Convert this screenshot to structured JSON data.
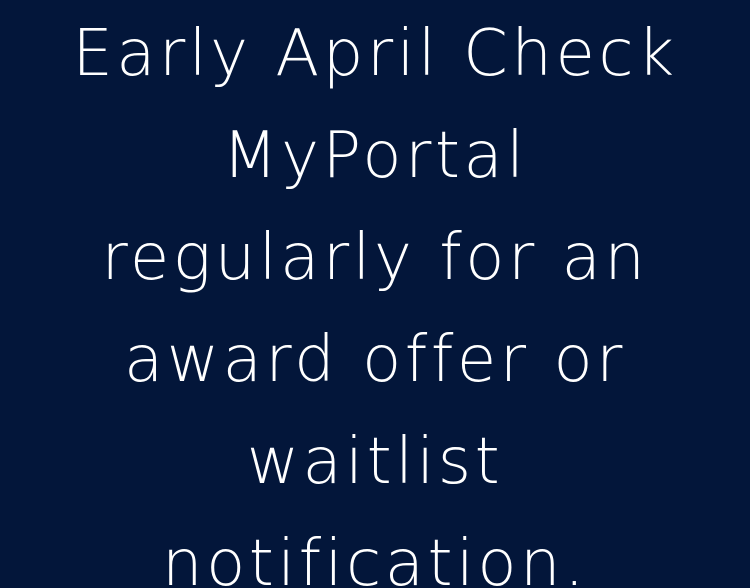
{
  "background_color": "#03163a",
  "text_color": "#ffffff",
  "lines": [
    "Early April Check",
    "MyPortal",
    "regularly for an",
    "award offer or",
    "waitlist",
    "notification."
  ]
}
